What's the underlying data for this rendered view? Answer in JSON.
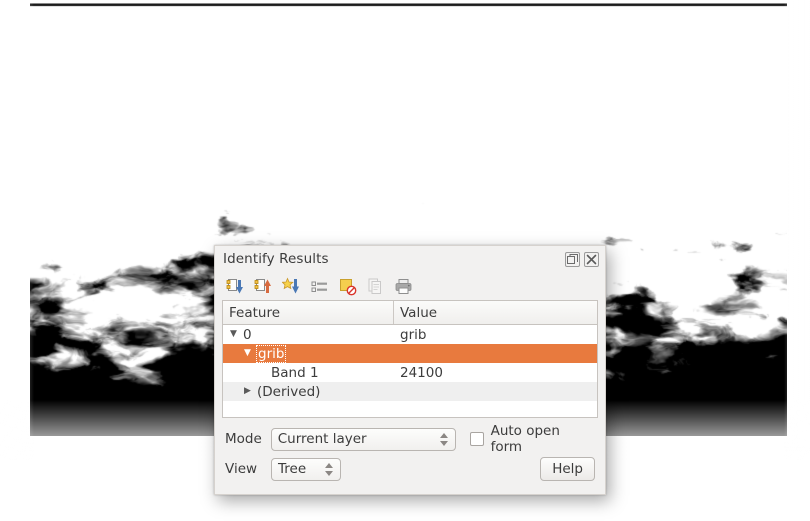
{
  "map": {
    "name": "raster-map-canvas",
    "description": "grib raster layer rendered in black and white"
  },
  "panel": {
    "title": "Identify Results",
    "titlebar_buttons": [
      {
        "name": "float-panel-button",
        "icon": "float-icon"
      },
      {
        "name": "close-panel-button",
        "icon": "close-icon"
      }
    ],
    "toolbar": [
      {
        "name": "expand-new-results-button",
        "icon": "expand-new-results-icon",
        "enabled": true
      },
      {
        "name": "collapse-all-button",
        "icon": "collapse-all-icon",
        "enabled": true
      },
      {
        "name": "expand-all-button",
        "icon": "expand-all-icon",
        "enabled": true
      },
      {
        "name": "toggle-attribute-list-button",
        "icon": "list-view-icon",
        "enabled": true
      },
      {
        "name": "clear-results-button",
        "icon": "clear-results-icon",
        "enabled": true
      },
      {
        "name": "copy-feature-button",
        "icon": "copy-document-icon",
        "enabled": false
      },
      {
        "name": "print-button",
        "icon": "printer-icon",
        "enabled": true
      }
    ],
    "tree": {
      "columns": [
        "Feature",
        "Value"
      ],
      "rows": [
        {
          "depth": 0,
          "twisty": "expanded",
          "feature": "0",
          "value": "grib",
          "style": "plain"
        },
        {
          "depth": 1,
          "twisty": "expanded",
          "feature": "grib",
          "value": "",
          "style": "selected"
        },
        {
          "depth": 2,
          "twisty": "none",
          "feature": "Band 1",
          "value": "24100",
          "style": "plain"
        },
        {
          "depth": 1,
          "twisty": "collapsed",
          "feature": "(Derived)",
          "value": "",
          "style": "alt"
        }
      ]
    },
    "controls": {
      "mode_label": "Mode",
      "mode_value": "Current layer",
      "auto_open_form_label": "Auto open form",
      "auto_open_form_checked": false,
      "view_label": "View",
      "view_value": "Tree",
      "help_label": "Help"
    }
  },
  "colors": {
    "selection_orange": "#e87a3e",
    "panel_background": "#f2f1f0",
    "text": "#3c3c3c"
  }
}
